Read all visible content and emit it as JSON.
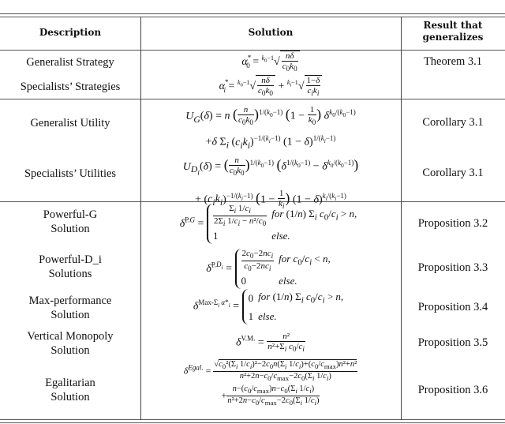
{
  "table": {
    "headers": {
      "description": "Description",
      "solution": "Solution",
      "result_line1": "Result that",
      "result_line2": "generalizes"
    },
    "rows": [
      {
        "description": [
          "Generalist Strategy",
          "Specialists’ Strategies"
        ],
        "solution": [
          "α*_0 = (k_0−1)√(nδ / (c_0 k_0))",
          "α*_i = (k_0−1)√(nδ / (c_0 k_0)) + (k_i−1)√((1−δ) / (c_i k_i))"
        ],
        "result": "Theorem 3.1"
      },
      {
        "description": [
          "Generalist Utility"
        ],
        "solution": [
          "U_G(δ) = n (n / (c_0 k_0))^(1/(k_0−1)) (1 − 1/k_0) δ^(k_0/(k_0−1))",
          "+δ Σ_i (c_i k_i)^(−1/(k_i−1)) (1 − δ)^(1/(k_i−1))"
        ],
        "result": "Corollary 3.1"
      },
      {
        "description": [
          "Specialists’ Utilities"
        ],
        "solution": [
          "U_{D_i}(δ) = (n / (c_0 k_0))^(1/(k_0−1)) (δ^(1/(k_0−1)) − δ^(k_0/(k_0−1)))",
          "+ (c_i k_i)^(−1/(k_i−1)) (1 − 1/k_i) (1 − δ)^(k_i/(k_i−1))"
        ],
        "result": "Corollary 3.1"
      },
      {
        "description": [
          "Powerful-G",
          "Solution"
        ],
        "solution": [
          "δ^{P.G} = Σ_i (1/c_i) / (2 Σ_i (1/c_i) − n²/c_0)  for (1/n) Σ_i c_0/c_i > n,",
          "1  else."
        ],
        "result": "Proposition 3.2"
      },
      {
        "description": [
          "Powerful-D_i",
          "Solutions"
        ],
        "solution": [
          "δ^{P.D_i} = (2c_0 − 2nc_i) / (c_0 − 2nc_i)  for c_0/c_i < n,",
          "0  else."
        ],
        "result": "Proposition 3.3"
      },
      {
        "description": [
          "Max-performance",
          "Solution"
        ],
        "solution": [
          "δ^{Max-Σ_i α*_i} = 0  for (1/n) Σ_i c_0/c_i > n,",
          "1  else."
        ],
        "result": "Proposition 3.4"
      },
      {
        "description": [
          "Vertical Monopoly",
          "Solution"
        ],
        "solution": [
          "δ^{V.M.} = n² / (n² + Σ_i c_0/c_i)"
        ],
        "result": "Proposition 3.5"
      },
      {
        "description": [
          "Egalitarian",
          "Solution"
        ],
        "solution": [
          "δ^{Egal.} = √(c_0²(Σ_i 1/c_i)² − 2c_0 n(Σ_i 1/c_i) + (c_0/c_max) n² + n²) / (n² + 2n − c_0/c_max − 2c_0(Σ_i 1/c_i))",
          "+ (n − (c_0/c_max) n − c_0(Σ_i 1/c_i)) / (n² + 2n − c_0/c_max − 2c_0(Σ_i 1/c_i))"
        ],
        "result": "Proposition 3.6"
      }
    ],
    "math_text": {
      "else": "else.",
      "for": "for"
    }
  }
}
